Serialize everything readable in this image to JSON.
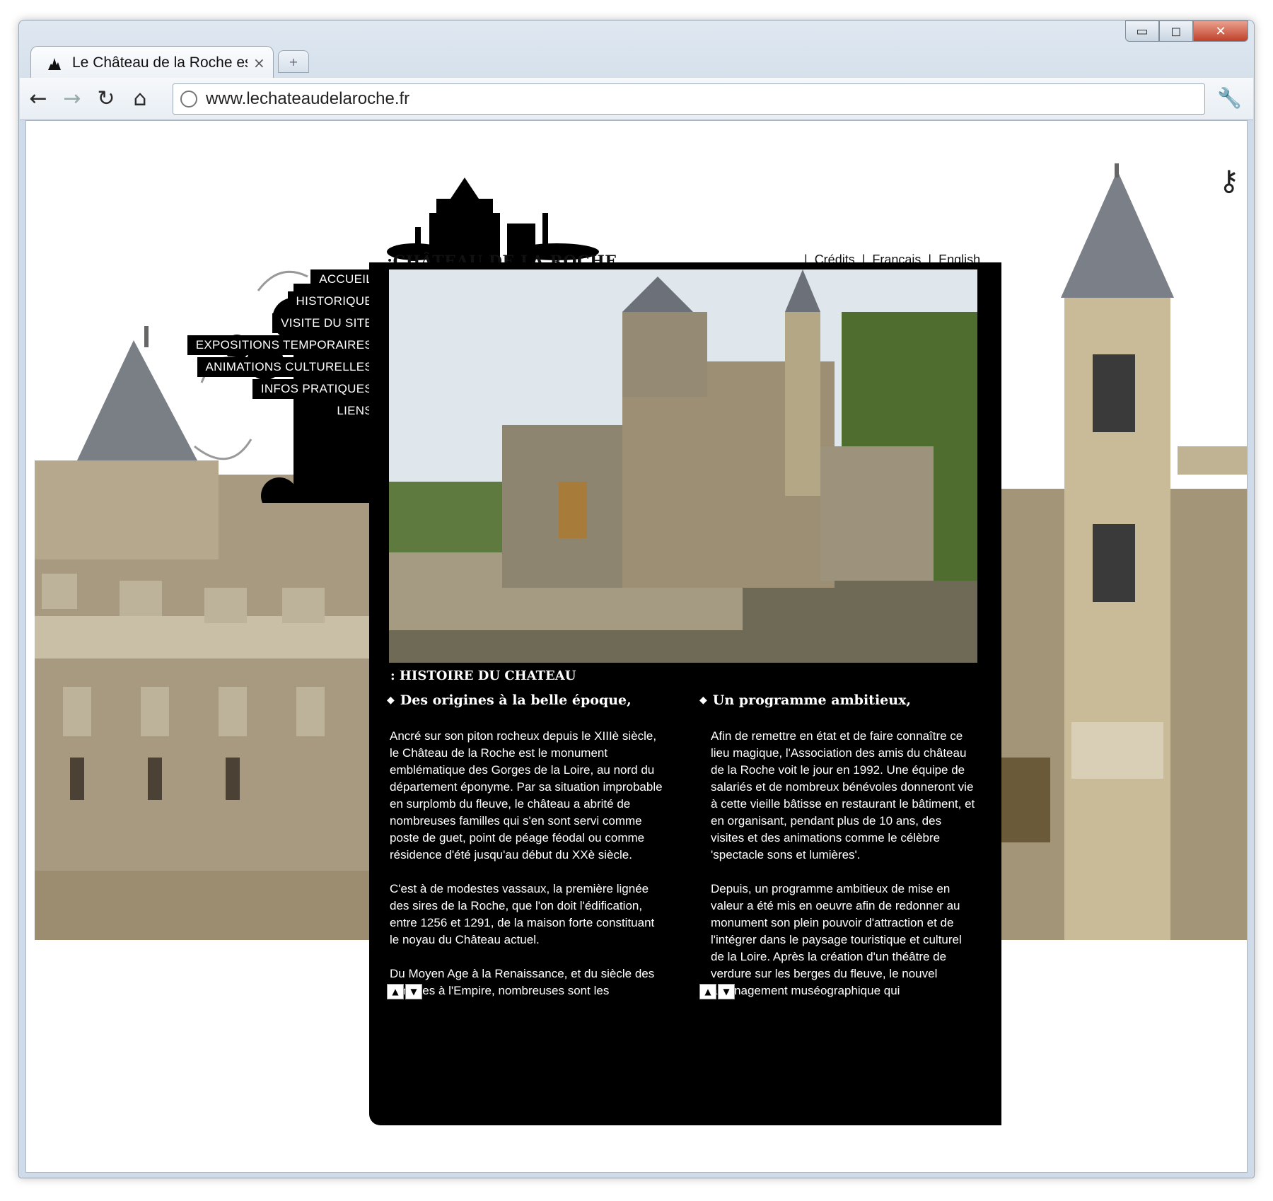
{
  "browser": {
    "tab_title": "Le Château de la Roche est",
    "tab_close": "×",
    "new_tab": "+",
    "url": "www.lechateaudelaroche.fr",
    "window_controls": {
      "minimize": "▭",
      "maximize": "◻",
      "close": "✕"
    },
    "nav": {
      "back": "←",
      "forward": "→",
      "reload": "↻",
      "home": "⌂",
      "menu": "🔧"
    }
  },
  "site": {
    "logo_text": ":CHÂTEAU DE LA ROCHE",
    "top_links": [
      "Crédits",
      "Français",
      "English"
    ],
    "menu": [
      "ACCUEIL",
      "HISTORIQUE",
      "VISITE DU SITE",
      "EXPOSITIONS TEMPORAIRES",
      "ANIMATIONS CULTURELLES",
      "INFOS PRATIQUES",
      "LIENS"
    ],
    "section_title": ": HISTOIRE DU CHATEAU",
    "left": {
      "heading": "Des origines à la belle époque,",
      "paragraphs": [
        "Ancré sur son piton rocheux depuis le XIIIè siècle, le Château de la Roche est le monument emblématique des Gorges de la Loire, au nord du département éponyme. Par sa situation improbable en surplomb du fleuve, le château a abrité de nombreuses familles qui s'en sont servi comme poste de guet, point de péage féodal ou comme résidence d'été jusqu'au début du XXè siècle.",
        "C'est à de modestes vassaux, la première lignée des sires de la Roche, que l'on doit l'édification, entre 1256 et 1291, de la maison forte constituant le noyau du Château actuel.",
        "Du Moyen Age à la Renaissance, et du siècle des lumières à l'Empire, nombreuses sont les"
      ]
    },
    "right": {
      "heading": "Un programme ambitieux,",
      "paragraphs": [
        "Afin de remettre en état et de faire connaître ce lieu magique, l'Association des amis du château de la Roche voit le jour en 1992. Une équipe de salariés et de nombreux bénévoles donneront vie à cette vieille bâtisse en restaurant le bâtiment, et en organisant, pendant plus de 10 ans,  des visites et des animations comme le célèbre 'spectacle sons et lumières'.",
        "Depuis, un programme ambitieux de mise en valeur a été mis en oeuvre afin de redonner au monument son plein pouvoir d'attraction et de l'intégrer dans le paysage touristique et culturel de la Loire. Après la création d'un théâtre de verdure sur les berges du fleuve, le nouvel aménagement muséographique qui"
      ]
    },
    "scroll_up": "▲",
    "scroll_down": "▼"
  }
}
